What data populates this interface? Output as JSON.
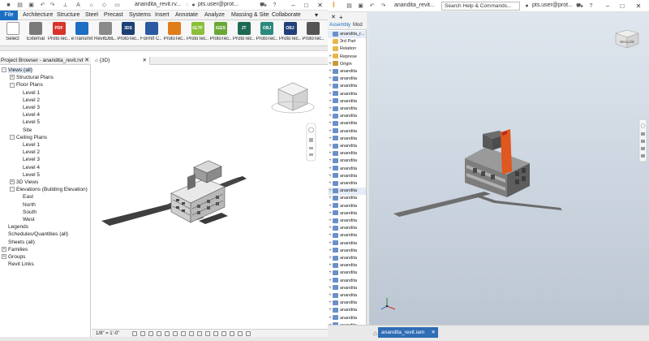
{
  "revit": {
    "title": {
      "document": "anandita_revit.rv...",
      "user": "pts.user@prot..."
    },
    "tabs": [
      "File",
      "Architecture",
      "Structure",
      "Steel",
      "Precast",
      "Systems",
      "Insert",
      "Annotate",
      "Analyze",
      "Massing & Site",
      "Collaborate"
    ],
    "ribbon": [
      {
        "label": "Select",
        "badge": "",
        "color": "#ffffff"
      },
      {
        "label": "External",
        "badge": "",
        "color": "#7a7a7a"
      },
      {
        "label": "ProtoTec...",
        "badge": "PDF",
        "color": "#d6342c"
      },
      {
        "label": "eTransmit",
        "badge": "",
        "color": "#1b6ec2"
      },
      {
        "label": "RevitDBL...",
        "badge": "",
        "color": "#8a8a8a"
      },
      {
        "label": "ProtoTec...",
        "badge": "3DS",
        "color": "#1d3f73"
      },
      {
        "label": "FormIt C...",
        "badge": "",
        "color": "#2b5aa3"
      },
      {
        "label": "ProtoTec...",
        "badge": "",
        "color": "#e07c1a"
      },
      {
        "label": "ProtoTec...",
        "badge": "GLTF",
        "color": "#8bbf3a"
      },
      {
        "label": "ProtoTec...",
        "badge": "IGES",
        "color": "#6aa836"
      },
      {
        "label": "ProtoTec...",
        "badge": "JT",
        "color": "#1e6a55"
      },
      {
        "label": "ProtoTec...",
        "badge": "OBJ",
        "color": "#2a8a7c"
      },
      {
        "label": "ProtoTec...",
        "badge": "OBJ",
        "color": "#21407a"
      },
      {
        "label": "ProtoTec...",
        "badge": "",
        "color": "#555555"
      }
    ],
    "project_browser": {
      "title": "Project Browser - anandita_revit.rvt",
      "items": [
        {
          "label": "Views (all)",
          "level": 0,
          "exp": "-",
          "selected": true
        },
        {
          "label": "Structural Plans",
          "level": 1,
          "exp": "+"
        },
        {
          "label": "Floor Plans",
          "level": 1,
          "exp": "-"
        },
        {
          "label": "Level 1",
          "level": 2,
          "exp": ""
        },
        {
          "label": "Level 2",
          "level": 2,
          "exp": ""
        },
        {
          "label": "Level 3",
          "level": 2,
          "exp": ""
        },
        {
          "label": "Level 4",
          "level": 2,
          "exp": ""
        },
        {
          "label": "Level 5",
          "level": 2,
          "exp": ""
        },
        {
          "label": "Site",
          "level": 2,
          "exp": ""
        },
        {
          "label": "Ceiling Plans",
          "level": 1,
          "exp": "-"
        },
        {
          "label": "Level 1",
          "level": 2,
          "exp": ""
        },
        {
          "label": "Level 2",
          "level": 2,
          "exp": ""
        },
        {
          "label": "Level 3",
          "level": 2,
          "exp": ""
        },
        {
          "label": "Level 4",
          "level": 2,
          "exp": ""
        },
        {
          "label": "Level 5",
          "level": 2,
          "exp": ""
        },
        {
          "label": "3D Views",
          "level": 1,
          "exp": "+"
        },
        {
          "label": "Elevations (Building Elevation)",
          "level": 1,
          "exp": "-"
        },
        {
          "label": "East",
          "level": 2,
          "exp": ""
        },
        {
          "label": "North",
          "level": 2,
          "exp": ""
        },
        {
          "label": "South",
          "level": 2,
          "exp": ""
        },
        {
          "label": "West",
          "level": 2,
          "exp": ""
        },
        {
          "label": "Legends",
          "level": 0,
          "exp": ""
        },
        {
          "label": "Schedules/Quantities (all)",
          "level": 0,
          "exp": ""
        },
        {
          "label": "Sheets (all)",
          "level": 0,
          "exp": ""
        },
        {
          "label": "Families",
          "level": 0,
          "exp": "+"
        },
        {
          "label": "Groups",
          "level": 0,
          "exp": "+"
        },
        {
          "label": "Revit Links",
          "level": 0,
          "exp": ""
        }
      ]
    },
    "view_tab": "{3D}",
    "view_scale": "1/8\" = 1'-0\""
  },
  "inventor": {
    "title": {
      "document": "anandita_revit...",
      "search_placeholder": "Search Help & Commands...",
      "user": "pts.user@prot..."
    },
    "panel": {
      "assembly_label": "Assembly",
      "model_label": "Mod"
    },
    "browser": [
      {
        "label": "anandita_r...",
        "icon": "part",
        "plus": false,
        "highlight": true
      },
      {
        "label": "3rd Part",
        "icon": "folder",
        "plus": false
      },
      {
        "label": "Relation",
        "icon": "folder",
        "plus": false
      },
      {
        "label": "Represe",
        "icon": "folder",
        "plus": true
      },
      {
        "label": "Origin",
        "icon": "origin",
        "plus": true
      },
      {
        "label": "anandita",
        "icon": "part",
        "plus": true
      },
      {
        "label": "anandita",
        "icon": "part",
        "plus": true
      },
      {
        "label": "anandita",
        "icon": "part",
        "plus": true
      },
      {
        "label": "anandita",
        "icon": "part",
        "plus": true
      },
      {
        "label": "anandita",
        "icon": "part",
        "plus": true
      },
      {
        "label": "anandita",
        "icon": "part",
        "plus": true
      },
      {
        "label": "anandita",
        "icon": "part",
        "plus": true
      },
      {
        "label": "anandita",
        "icon": "part",
        "plus": true
      },
      {
        "label": "anandita",
        "icon": "part",
        "plus": true
      },
      {
        "label": "anandita",
        "icon": "part",
        "plus": true
      },
      {
        "label": "anandita",
        "icon": "part",
        "plus": true
      },
      {
        "label": "anandita",
        "icon": "part",
        "plus": true
      },
      {
        "label": "anandita",
        "icon": "part",
        "plus": true
      },
      {
        "label": "anandita",
        "icon": "part",
        "plus": true
      },
      {
        "label": "anandita",
        "icon": "part",
        "plus": true
      },
      {
        "label": "anandita",
        "icon": "part",
        "plus": true
      },
      {
        "label": "anandita",
        "icon": "part",
        "plus": true,
        "highlight": true
      },
      {
        "label": "anandita",
        "icon": "part",
        "plus": true
      },
      {
        "label": "anandita",
        "icon": "part",
        "plus": true
      },
      {
        "label": "anandita",
        "icon": "part",
        "plus": true
      },
      {
        "label": "anandita",
        "icon": "part",
        "plus": true
      },
      {
        "label": "anandita",
        "icon": "part",
        "plus": true
      },
      {
        "label": "anandita",
        "icon": "part",
        "plus": true
      },
      {
        "label": "anandita",
        "icon": "part",
        "plus": true
      },
      {
        "label": "anandita",
        "icon": "part",
        "plus": true
      },
      {
        "label": "anandita",
        "icon": "part",
        "plus": true
      },
      {
        "label": "anandita",
        "icon": "part",
        "plus": true
      },
      {
        "label": "anandita",
        "icon": "part",
        "plus": true
      },
      {
        "label": "anandita",
        "icon": "part",
        "plus": true
      },
      {
        "label": "anandita",
        "icon": "part",
        "plus": true
      },
      {
        "label": "anandita",
        "icon": "part",
        "plus": true
      },
      {
        "label": "anandita",
        "icon": "part",
        "plus": true
      },
      {
        "label": "anandita",
        "icon": "part",
        "plus": true
      },
      {
        "label": "anandita",
        "icon": "part",
        "plus": true
      },
      {
        "label": "anandita",
        "icon": "part",
        "plus": true
      }
    ],
    "viewcube_label": "WALLDE",
    "doc_tab": "anandita_revit.iam"
  },
  "colors": {
    "revit_accent": "#1b6ec2",
    "inventor_tab": "#2f6db5",
    "building_accent": "#e0571f"
  }
}
